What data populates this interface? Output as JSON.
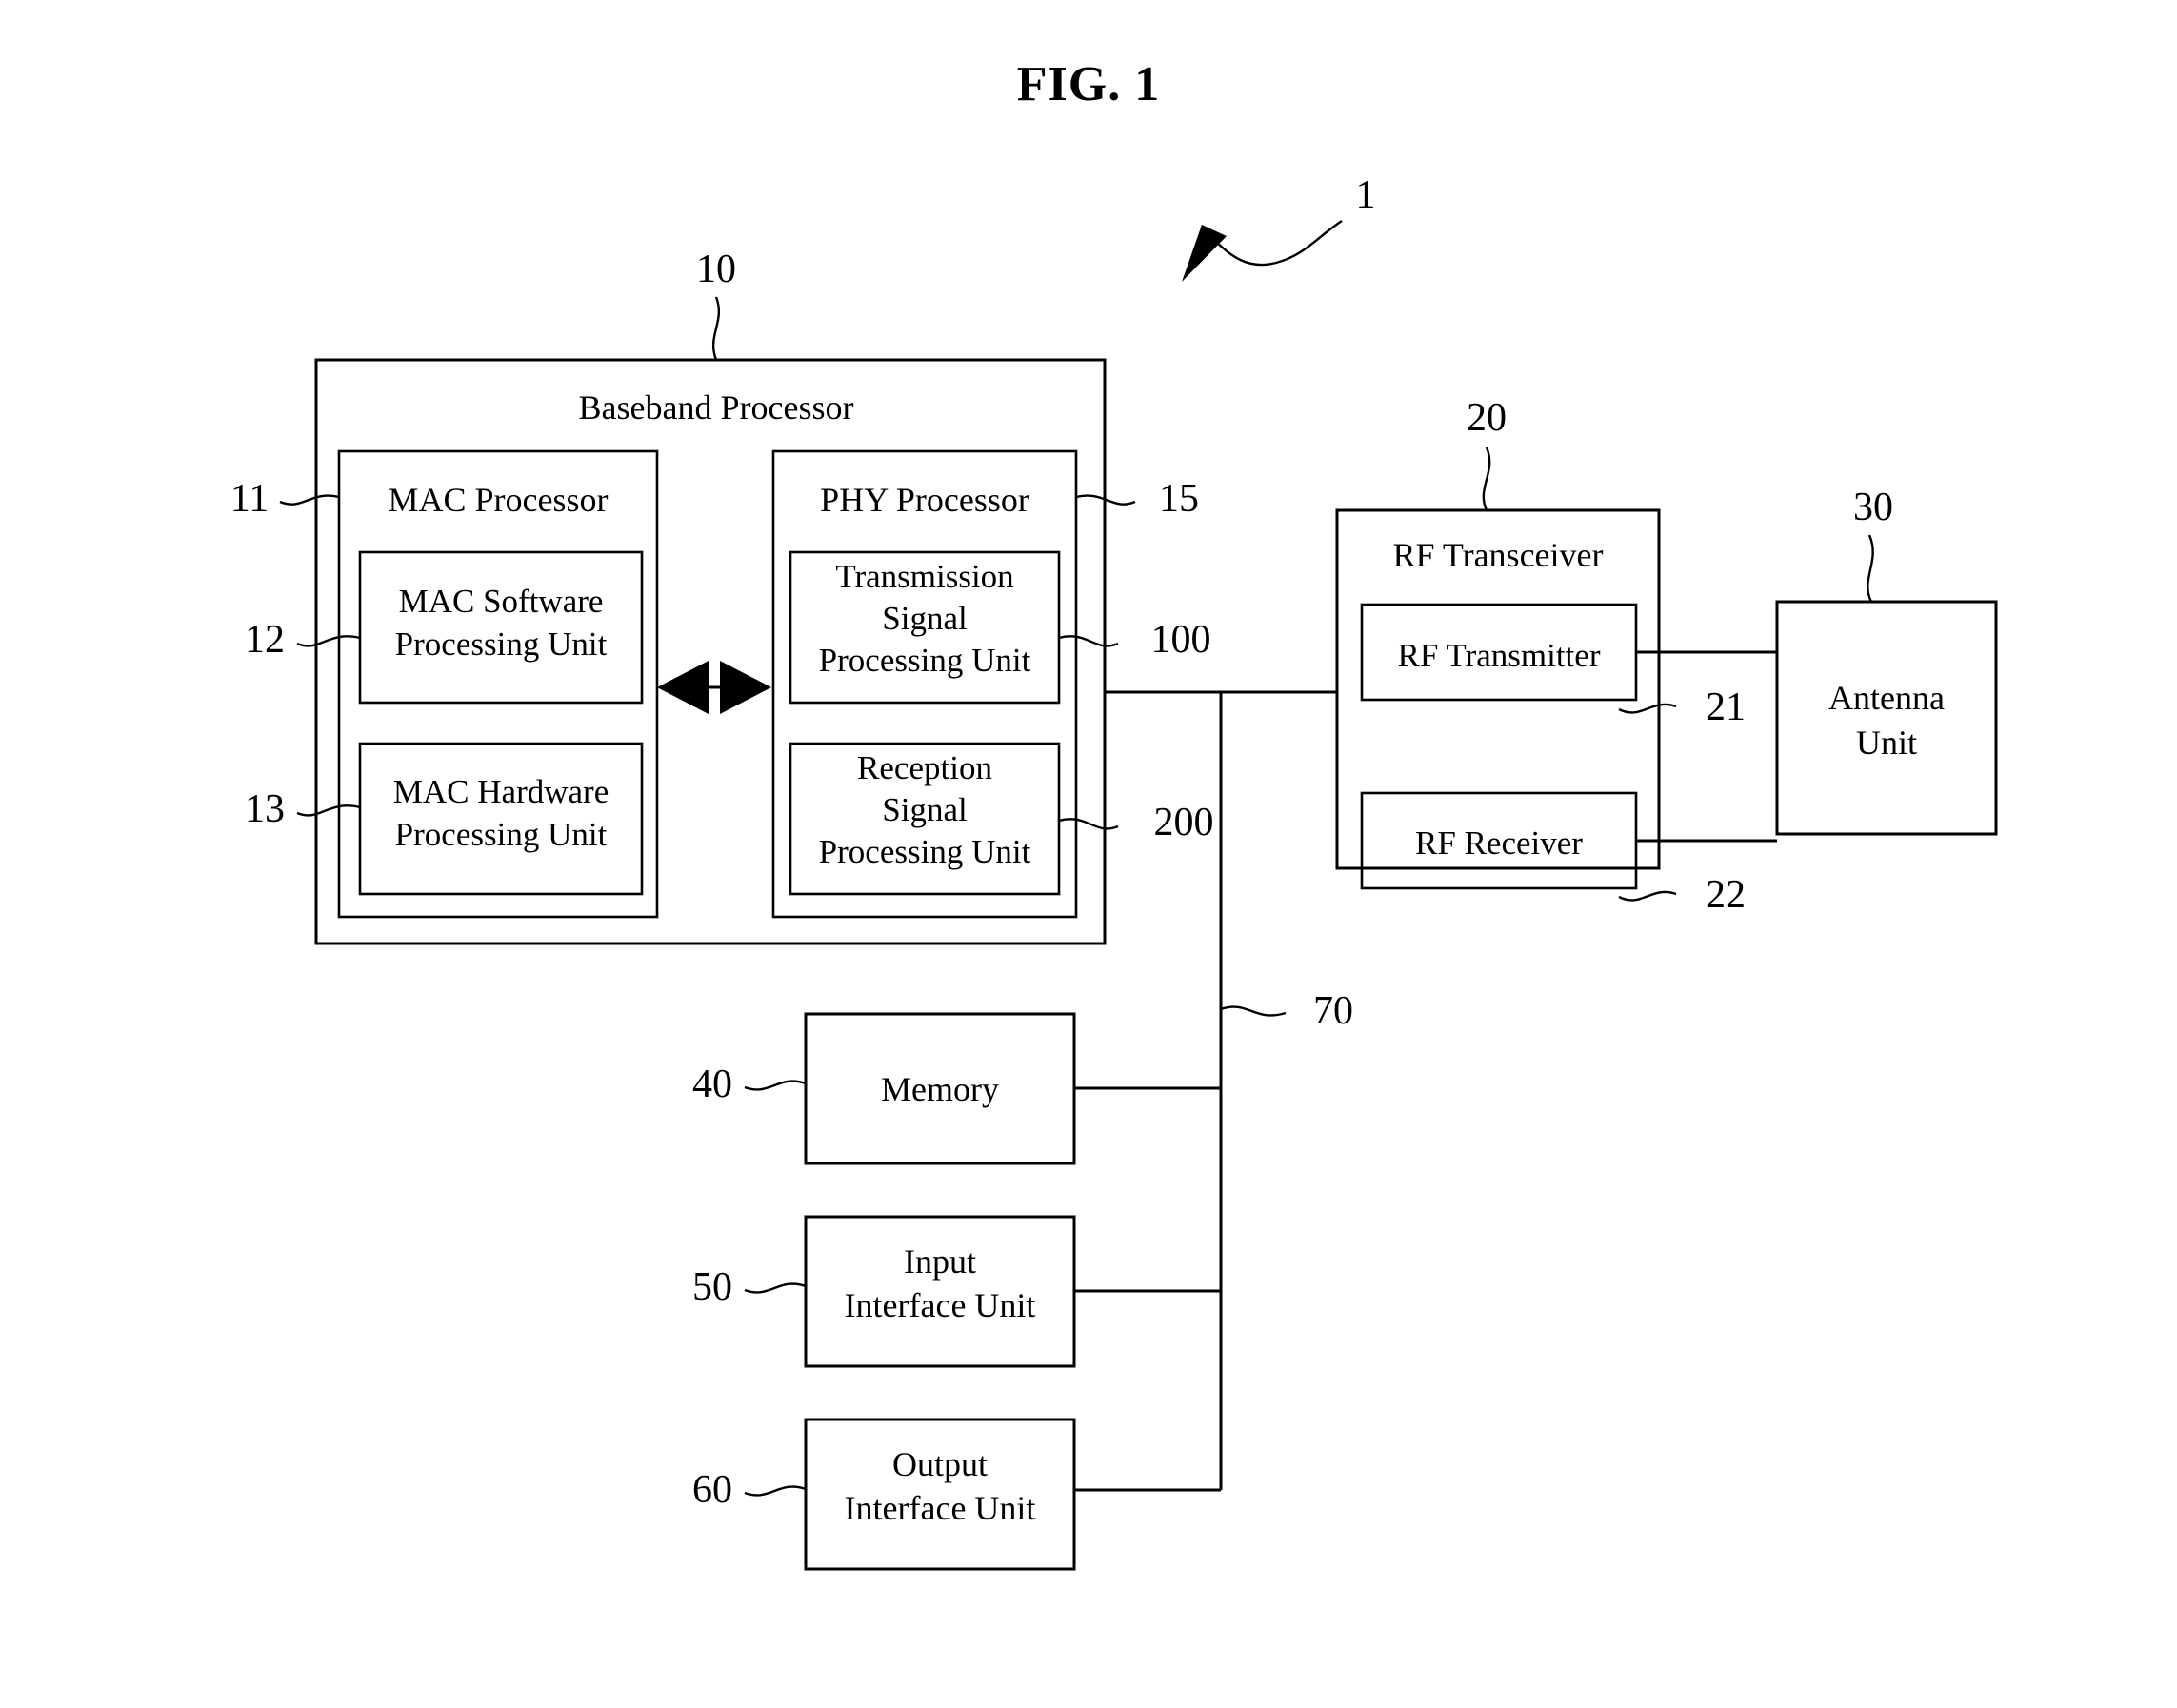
{
  "figure": {
    "title": "FIG. 1",
    "system_ref": "1"
  },
  "blocks": {
    "baseband_processor": {
      "label": "Baseband Processor",
      "ref": "10"
    },
    "mac_processor": {
      "label": "MAC Processor",
      "ref": "11"
    },
    "mac_software_processing_unit": {
      "line1": "MAC Software",
      "line2": "Processing Unit",
      "ref": "12"
    },
    "mac_hardware_processing_unit": {
      "line1": "MAC Hardware",
      "line2": "Processing Unit",
      "ref": "13"
    },
    "phy_processor": {
      "label": "PHY Processor",
      "ref": "15"
    },
    "transmission_signal_processing_unit": {
      "line1": "Transmission",
      "line2": "Signal",
      "line3": "Processing Unit",
      "ref": "100"
    },
    "reception_signal_processing_unit": {
      "line1": "Reception",
      "line2": "Signal",
      "line3": "Processing Unit",
      "ref": "200"
    },
    "rf_transceiver": {
      "label": "RF Transceiver",
      "ref": "20"
    },
    "rf_transmitter": {
      "label": "RF Transmitter",
      "ref": "21"
    },
    "rf_receiver": {
      "label": "RF Receiver",
      "ref": "22"
    },
    "antenna_unit": {
      "line1": "Antenna",
      "line2": "Unit",
      "ref": "30"
    },
    "memory": {
      "label": "Memory",
      "ref": "40"
    },
    "input_interface_unit": {
      "line1": "Input",
      "line2": "Interface Unit",
      "ref": "50"
    },
    "output_interface_unit": {
      "line1": "Output",
      "line2": "Interface Unit",
      "ref": "60"
    },
    "bus": {
      "ref": "70"
    }
  },
  "colors": {
    "line": "#000000",
    "background": "#ffffff"
  }
}
